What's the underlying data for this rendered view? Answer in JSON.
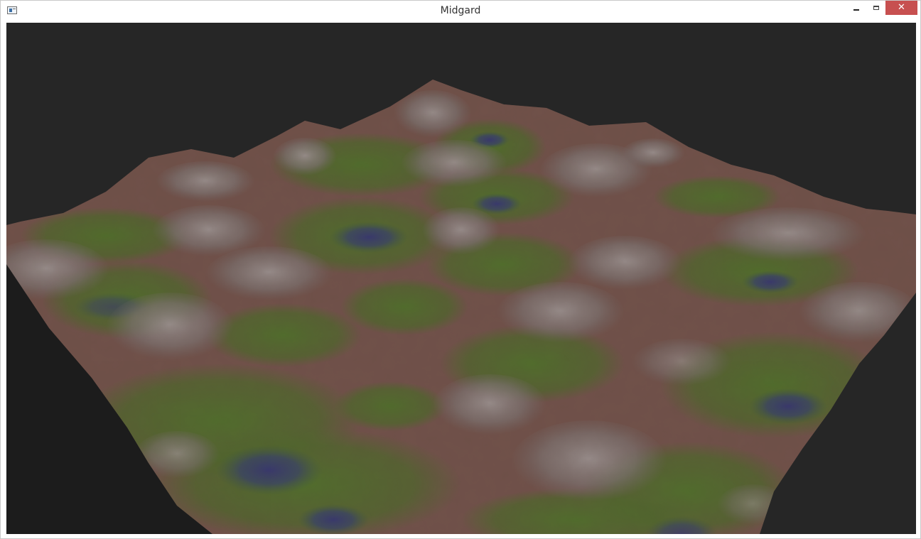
{
  "window": {
    "title": "Midgard",
    "icons": {
      "app": "app-window-icon",
      "minimize": "minimize-icon",
      "maximize": "maximize-icon",
      "close": "close-icon"
    },
    "close_glyph": "✕"
  },
  "viewport": {
    "background": "#262626",
    "scene": "3d-terrain"
  },
  "terrain_colors": {
    "peak": "#8a8a8a",
    "soil": "#6e5048",
    "grass": "#3f6e1e",
    "water": "#22306f"
  }
}
